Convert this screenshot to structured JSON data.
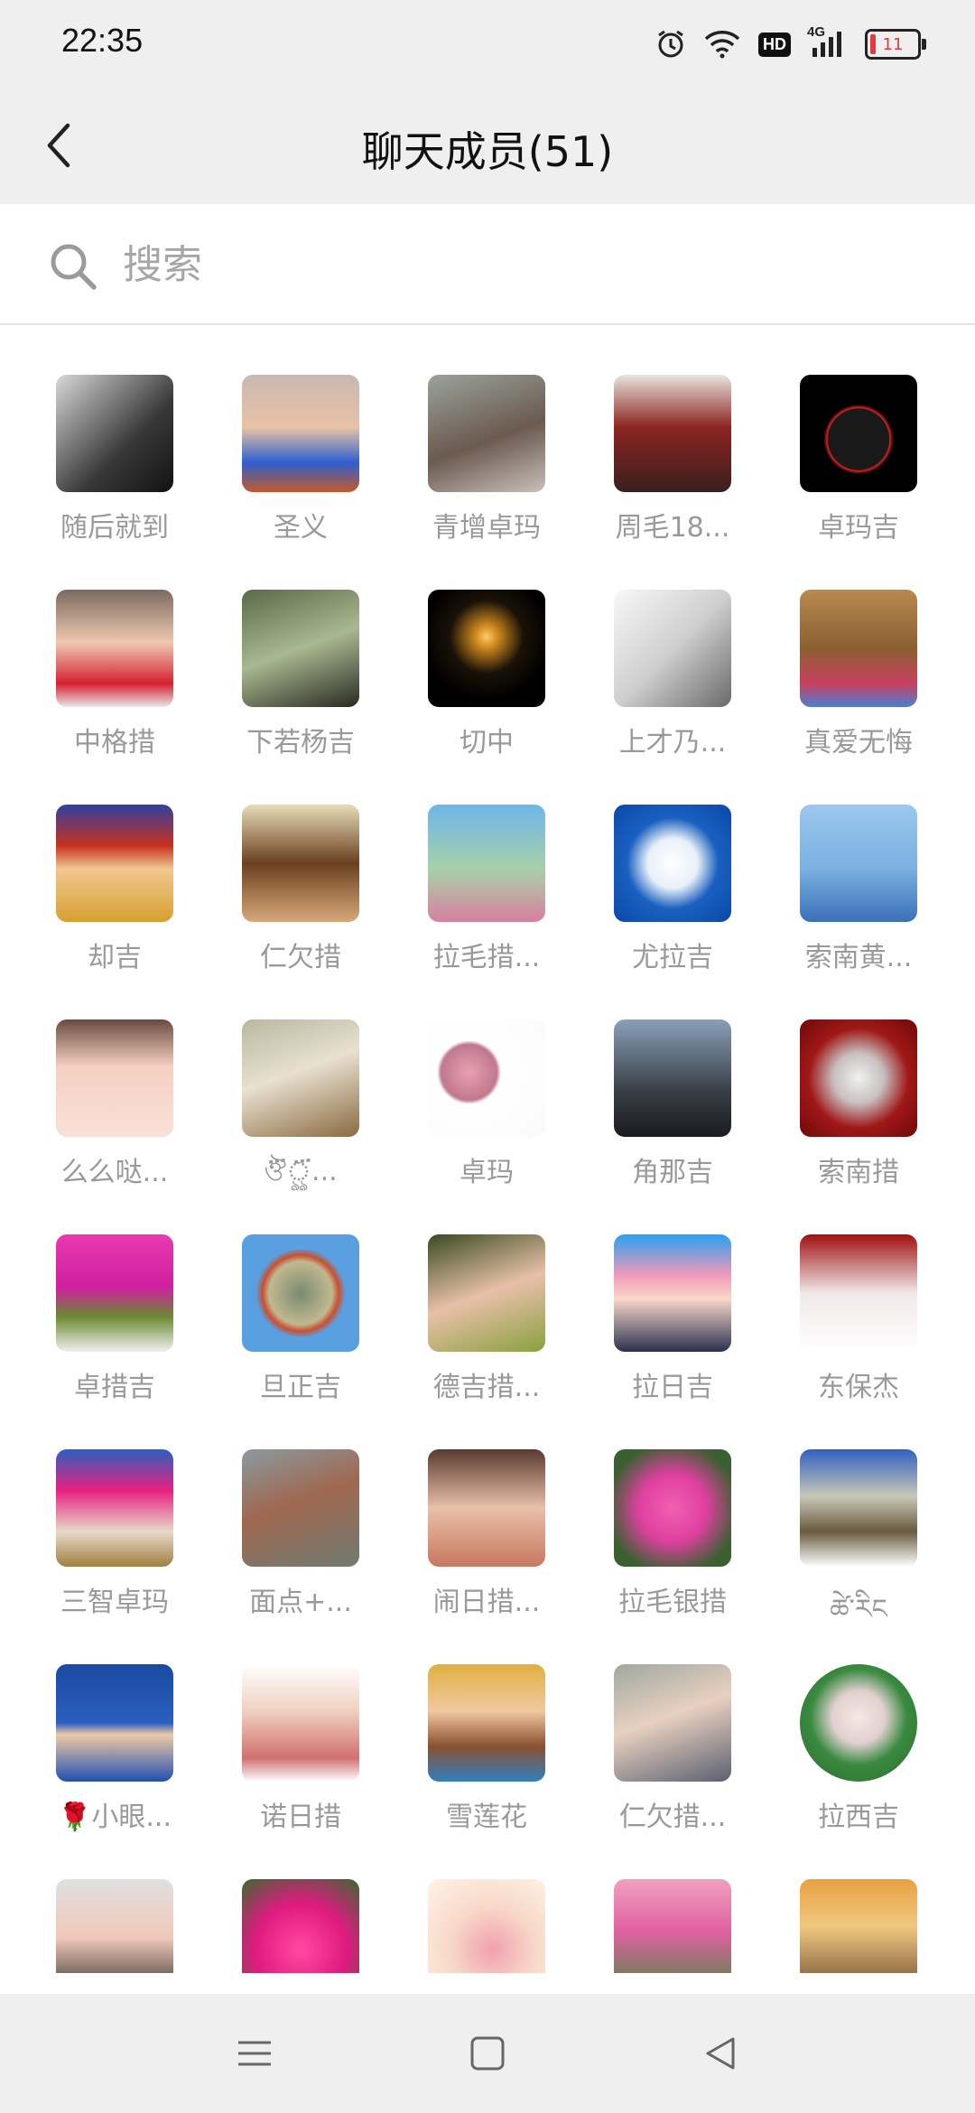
{
  "status": {
    "time": "22:35",
    "hd": "HD",
    "network": "4G",
    "battery": "11",
    "icons": [
      "alarm-icon",
      "wifi-icon",
      "hd-icon",
      "signal-icon",
      "battery-icon"
    ]
  },
  "header": {
    "title": "聊天成员(51)",
    "back_icon": "chevron-left-icon"
  },
  "search": {
    "placeholder": "搜索",
    "value": ""
  },
  "members": [
    {
      "name": "随后就到",
      "bg": "linear-gradient(135deg,#d8d8d8,#3a3a3a 60%,#111)"
    },
    {
      "name": "圣义",
      "bg": "linear-gradient(180deg,#c9b8b0 0%,#e8c2a6 45%,#2f5fd0 75%,#c45a2a 100%)"
    },
    {
      "name": "青增卓玛",
      "bg": "linear-gradient(160deg,#9aa39a,#6b5a50 55%,#c9c0b8)"
    },
    {
      "name": "周毛18...",
      "bg": "linear-gradient(180deg,#e8e4de 0%,#8c2420 45%,#3a2020 100%)"
    },
    {
      "name": "卓玛吉",
      "bg": "radial-gradient(circle at 50% 55%,#1a1a1a 35%,#d22 36%,#000 40%)"
    },
    {
      "name": "中格措",
      "bg": "linear-gradient(180deg,#7b6a60 0%,#f0c8b0 45%,#d42030 80%,#e8e8e8 100%)"
    },
    {
      "name": "下若杨吉",
      "bg": "linear-gradient(160deg,#5a6a48,#a8b890 50%,#2a2a22)"
    },
    {
      "name": "切中",
      "bg": "radial-gradient(circle at 50% 40%,#ffcc66 0%,#d08a20 12%,#1a1208 40%,#000 70%)"
    },
    {
      "name": "上才乃...",
      "bg": "linear-gradient(135deg,#f8f8f8,#cfcfcf 50%,#6a6a6a)"
    },
    {
      "name": "真爱无悔",
      "bg": "linear-gradient(180deg,#b88a50 0%,#8a6030 50%,#c84060 80%,#4a80d0 100%)"
    },
    {
      "name": "却吉",
      "bg": "linear-gradient(180deg,#3040a0 0%,#c83020 35%,#f0c890 55%,#d8a030 100%)"
    },
    {
      "name": "仁欠措",
      "bg": "linear-gradient(180deg,#e8dcb8 0%,#6a4020 50%,#d8a878 100%)"
    },
    {
      "name": "拉毛措...",
      "bg": "linear-gradient(180deg,#6fb6e8 0%,#a8d0a8 55%,#d880a0 100%)"
    },
    {
      "name": "尤拉吉",
      "bg": "radial-gradient(ellipse at 50% 50%,#ffffff 0%,#e8f0f8 30%,#1a60c0 55%,#0a48a8 100%)"
    },
    {
      "name": "索南黄...",
      "bg": "linear-gradient(180deg,#9cc8ec 0%,#7ab0e0 55%,#3a70b8 100%)"
    },
    {
      "name": "么么哒...",
      "bg": "linear-gradient(180deg,#6a4a40 0%,#f4d0c0 40%,#f8e0d8 100%)"
    },
    {
      "name": "ঔ፝ৣ፝...",
      "bg": "linear-gradient(160deg,#b8b8a0,#e8e0d0 45%,#8a6a40)"
    },
    {
      "name": "卓玛",
      "bg": "radial-gradient(circle at 35% 45%,#e8a0b0 0%,#c07890 28%,#ffffff 32%,#fafafa 100%)"
    },
    {
      "name": "角那吉",
      "bg": "linear-gradient(180deg,#8aa0b8 0%,#3a4048 60%,#1a1c20 100%)"
    },
    {
      "name": "索南措",
      "bg": "radial-gradient(circle at 50% 50%,#f0f0f0 0%,#c8c0c0 30%,#a01818 60%,#700808 100%)"
    },
    {
      "name": "卓措吉",
      "bg": "linear-gradient(180deg,#e83ab0 0%,#d020a0 45%,#6a8a30 70%,#f0f0f0 100%)"
    },
    {
      "name": "旦正吉",
      "bg": "radial-gradient(circle at 50% 50%,#7a8a70 0%,#c0b890 38%,#c85030 46%,#5aa0e0 54%)"
    },
    {
      "name": "德吉措...",
      "bg": "linear-gradient(160deg,#3a4a20,#e8c0a8 50%,#8aa040)"
    },
    {
      "name": "拉日吉",
      "bg": "linear-gradient(180deg,#2aa0f0 0%,#f09ab8 35%,#f8d8c8 55%,#2a3050 100%)"
    },
    {
      "name": "东保杰",
      "bg": "linear-gradient(180deg,#a01010 0%,#f0e8e8 50%,#ffffff 100%)"
    },
    {
      "name": "三智卓玛",
      "bg": "linear-gradient(180deg,#2a60c0 0%,#e82080 35%,#e8d8c8 70%,#a08040 100%)"
    },
    {
      "name": "面点+...",
      "bg": "linear-gradient(160deg,#8a9aa0,#a06850 45%,#707a70)"
    },
    {
      "name": "闹日措...",
      "bg": "linear-gradient(180deg,#5a3a30 0%,#e8c0a8 50%,#c87860 100%)"
    },
    {
      "name": "拉毛银措",
      "bg": "radial-gradient(circle at 50% 50%,#f060b0 0%,#e040a0 40%,#3a6030 80%)"
    },
    {
      "name": "ཚེ་རིང",
      "bg": "linear-gradient(180deg,#3060c0 0%,#c8c8b8 40%,#6a5a40 70%,#ffffff 100%)"
    },
    {
      "name": "🌹小眼...",
      "bg": "linear-gradient(180deg,#1a4aa0 0%,#2a60c0 50%,#f0c8a8 60%,#2050b0 100%)"
    },
    {
      "name": "诺日措",
      "bg": "linear-gradient(180deg,#ffffff 0%,#f0d0c0 40%,#d07070 80%,#ffffff 100%)"
    },
    {
      "name": "雪莲花",
      "bg": "linear-gradient(180deg,#e0b040 0%,#f0c8a0 40%,#8a5030 70%,#3080c0 100%)"
    },
    {
      "name": "仁欠措...",
      "bg": "linear-gradient(160deg,#a0a8a0,#e8d0c0 45%,#5a6070)"
    },
    {
      "name": "拉西吉",
      "bg": "radial-gradient(circle at 50% 45%,#f8e8e0 0%,#e0d0d0 30%,#3a8a40 55%,#2a6a30 100%)",
      "shape": "circle"
    },
    {
      "name": "",
      "bg": "linear-gradient(180deg,#e0e0e0 0%,#f0c8b8 50%,#303030 100%)"
    },
    {
      "name": "",
      "bg": "radial-gradient(circle at 50% 60%,#ff4aa0 0%,#e01a80 50%,#3a6a30 100%)"
    },
    {
      "name": "",
      "bg": "radial-gradient(circle at 55% 60%,#f0a0b0 0%,#f8d8c8 45%,#fff4e8 100%)"
    },
    {
      "name": "",
      "bg": "linear-gradient(180deg,#f0a0c0 0%,#e060a0 45%,#4a8a40 100%)"
    },
    {
      "name": "",
      "bg": "linear-gradient(180deg,#e8a040 0%,#f0c880 40%,#6a4a30 100%)"
    }
  ],
  "navbar": {
    "menu_icon": "menu-icon",
    "home_icon": "home-square-icon",
    "back_icon": "back-triangle-icon"
  }
}
